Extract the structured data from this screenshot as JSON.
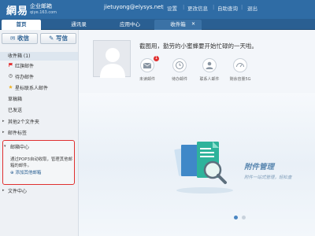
{
  "header": {
    "logo_main": "網易",
    "logo_sub": "企业邮箱",
    "domain": "qiye.163.com",
    "account": "jietuyong@elysys.net",
    "nav": [
      "设置",
      "更改信息",
      "自助查询",
      "退出"
    ]
  },
  "tabs": [
    "首页",
    "通讯录",
    "应用中心",
    "收件箱"
  ],
  "sidebar": {
    "receive_label": "收信",
    "compose_label": "写信",
    "folders": [
      "收件箱 (1)",
      "红旗邮件",
      "待办邮件",
      "星标联系人邮件",
      "草稿箱",
      "已发送"
    ],
    "groups": [
      "其他2个文件夹",
      "邮件标签"
    ],
    "mail_center": {
      "title": "邮箱中心",
      "desc": "通过POP3自动收取，管理其他邮箱的邮件。",
      "link": "添加其他邮箱"
    },
    "file_center": "文件中心"
  },
  "main": {
    "greeting": "截图用，勤劳的小蜜蜂要开始忙碌的一天啦。",
    "unread_badge": "1",
    "quick_labels": [
      "未读邮件",
      "待办邮件",
      "联系人邮件",
      "剩余容量5G"
    ],
    "promo_title": "附件管理",
    "promo_sub": "附件一站式管理，轻松查"
  },
  "colors": {
    "header_bg": "#2f6ca5",
    "accent": "#2a5f92",
    "alert": "#e03030"
  }
}
